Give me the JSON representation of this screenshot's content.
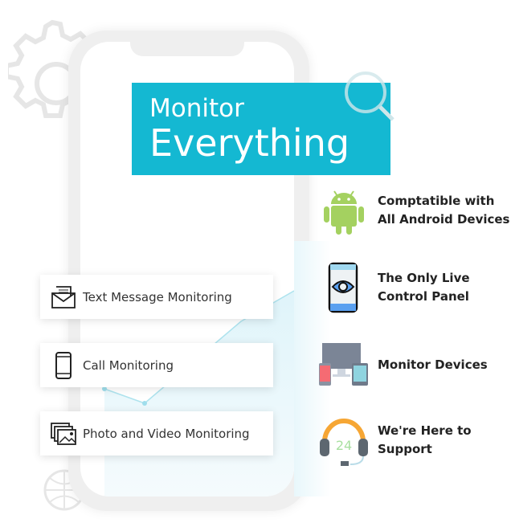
{
  "banner": {
    "line1": "Monitor",
    "line2": "Everything",
    "color": "#14b8d2"
  },
  "cards": [
    {
      "label": "Text Message Monitoring",
      "icon": "envelope-icon"
    },
    {
      "label": "Call Monitoring",
      "icon": "smartphone-icon"
    },
    {
      "label": "Photo and Video Monitoring",
      "icon": "photo-gallery-icon"
    }
  ],
  "features": [
    {
      "label": "Comptatible with\nAll Android Devices",
      "icon": "android-icon"
    },
    {
      "label": "The Only Live\nControl Panel",
      "icon": "phone-eye-icon"
    },
    {
      "label": "Monitor Devices",
      "icon": "devices-icon"
    },
    {
      "label": "We're Here to\nSupport",
      "icon": "headset-24-icon",
      "icon_text": "24"
    }
  ]
}
